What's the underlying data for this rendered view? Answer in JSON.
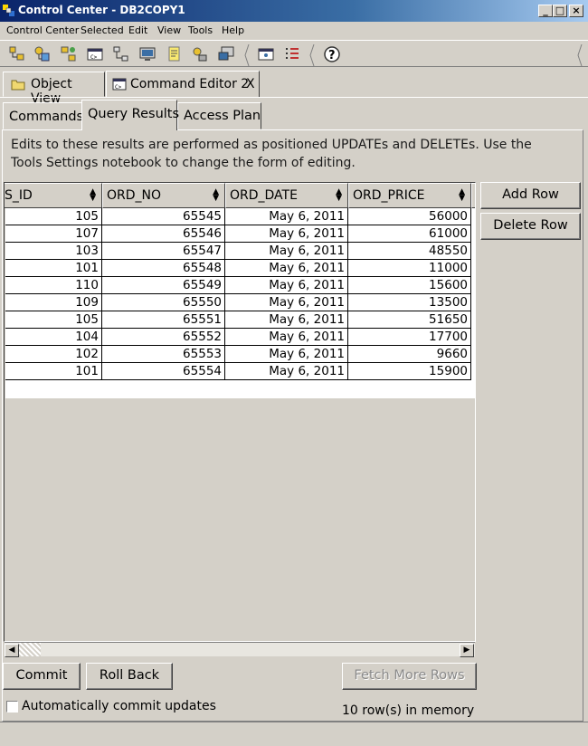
{
  "window": {
    "title": "Control Center - DB2COPY1"
  },
  "menu": [
    "Control Center",
    "Selected",
    "Edit",
    "View",
    "Tools",
    "Help"
  ],
  "editor_tabs": [
    {
      "label": "Object View"
    },
    {
      "label": "Command Editor 2",
      "close": "X"
    }
  ],
  "inner_tabs": [
    "Commands",
    "Query Results",
    "Access Plan"
  ],
  "info_text": "Edits to these results are performed as positioned UPDATEs and DELETEs.  Use the Tools Settings notebook to change the form of editing.",
  "grid": {
    "columns": [
      "S_ID",
      "ORD_NO",
      "ORD_DATE",
      "ORD_PRICE"
    ],
    "rows": [
      [
        "105",
        "65545",
        "May 6, 2011",
        "56000"
      ],
      [
        "107",
        "65546",
        "May 6, 2011",
        "61000"
      ],
      [
        "103",
        "65547",
        "May 6, 2011",
        "48550"
      ],
      [
        "101",
        "65548",
        "May 6, 2011",
        "11000"
      ],
      [
        "110",
        "65549",
        "May 6, 2011",
        "15600"
      ],
      [
        "109",
        "65550",
        "May 6, 2011",
        "13500"
      ],
      [
        "105",
        "65551",
        "May 6, 2011",
        "51650"
      ],
      [
        "104",
        "65552",
        "May 6, 2011",
        "17700"
      ],
      [
        "102",
        "65553",
        "May 6, 2011",
        "9660"
      ],
      [
        "101",
        "65554",
        "May 6, 2011",
        "15900"
      ]
    ]
  },
  "buttons": {
    "add_row": "Add Row",
    "delete_row": "Delete Row",
    "commit": "Commit",
    "roll_back": "Roll Back",
    "fetch_more": "Fetch More Rows"
  },
  "auto_commit": {
    "label": "Automatically commit updates",
    "checked": false
  },
  "status": "10 row(s) in memory",
  "toolbar_icons": [
    "object-tree-icon",
    "network-icon",
    "group-icon",
    "command-editor-icon",
    "relations-icon",
    "monitor-icon",
    "notes-icon",
    "key-user-icon",
    "system-icon",
    "view-panel-icon",
    "list-detail-icon",
    "help-icon"
  ],
  "colors": {
    "titlebar": "#0a246a",
    "face": "#d4d0c8",
    "grid_bg": "#ffffff"
  }
}
